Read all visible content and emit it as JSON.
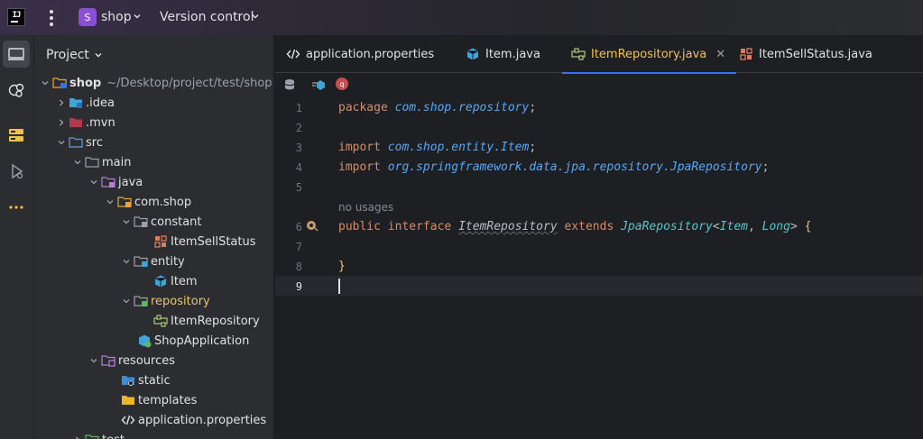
{
  "titlebar": {
    "logo_text": "IJ",
    "project_badge": "S",
    "project_name": "shop",
    "vcs_label": "Version control"
  },
  "toolstrip": {
    "items": [
      "project-icon",
      "services-icon",
      "structure-icon",
      "debug-icon",
      "more-icon"
    ]
  },
  "project_panel": {
    "title": "Project",
    "tree": [
      {
        "label": "shop",
        "path": "~/Desktop/project/test/shop",
        "icon": "module-folder-icon"
      },
      {
        "label": ".idea",
        "icon": "folder-icon"
      },
      {
        "label": ".mvn",
        "icon": "folder-icon"
      },
      {
        "label": "src",
        "icon": "source-folder-icon"
      },
      {
        "label": "main",
        "icon": "folder-icon"
      },
      {
        "label": "java",
        "icon": "java-folder-icon"
      },
      {
        "label": "com.shop",
        "icon": "package-icon"
      },
      {
        "label": "constant",
        "icon": "package-icon"
      },
      {
        "label": "ItemSellStatus",
        "icon": "enum-icon"
      },
      {
        "label": "entity",
        "icon": "package-icon"
      },
      {
        "label": "Item",
        "icon": "entity-icon"
      },
      {
        "label": "repository",
        "icon": "package-icon"
      },
      {
        "label": "ItemRepository",
        "icon": "interface-icon"
      },
      {
        "label": "ShopApplication",
        "icon": "spring-class-icon"
      },
      {
        "label": "resources",
        "icon": "resources-folder-icon"
      },
      {
        "label": "static",
        "icon": "web-folder-icon"
      },
      {
        "label": "templates",
        "icon": "folder-icon"
      },
      {
        "label": "application.properties",
        "icon": "properties-icon"
      },
      {
        "label": "test",
        "icon": "folder-icon"
      }
    ]
  },
  "tabs": [
    {
      "label": "application.properties",
      "icon": "properties-icon"
    },
    {
      "label": "Item.java",
      "icon": "entity-icon"
    },
    {
      "label": "ItemRepository.java",
      "icon": "interface-icon",
      "active": true
    },
    {
      "label": "ItemSellStatus.java",
      "icon": "enum-icon"
    }
  ],
  "editor": {
    "line_numbers": [
      "1",
      "2",
      "3",
      "4",
      "5",
      "6",
      "7",
      "8",
      "9"
    ],
    "usage_hint": "no usages",
    "lines": {
      "l1_kw": "package",
      "l1_pkg": "com.shop.repository",
      "l1_end": ";",
      "l3_kw": "import",
      "l3_pkg": "com.shop.entity.Item",
      "l3_end": ";",
      "l4_kw": "import",
      "l4_pkg": "org.springframework.data.jpa.repository.JpaRepository",
      "l4_end": ";",
      "l6_kw1": "public",
      "l6_kw2": "interface",
      "l6_name": "ItemRepository",
      "l6_kw3": "extends",
      "l6_type": "JpaRepository",
      "l6_lt": "<",
      "l6_t1": "Item",
      "l6_comma": ", ",
      "l6_t2": "Long",
      "l6_gt": ">",
      "l6_brace": "{",
      "l8_brace": "}"
    }
  }
}
